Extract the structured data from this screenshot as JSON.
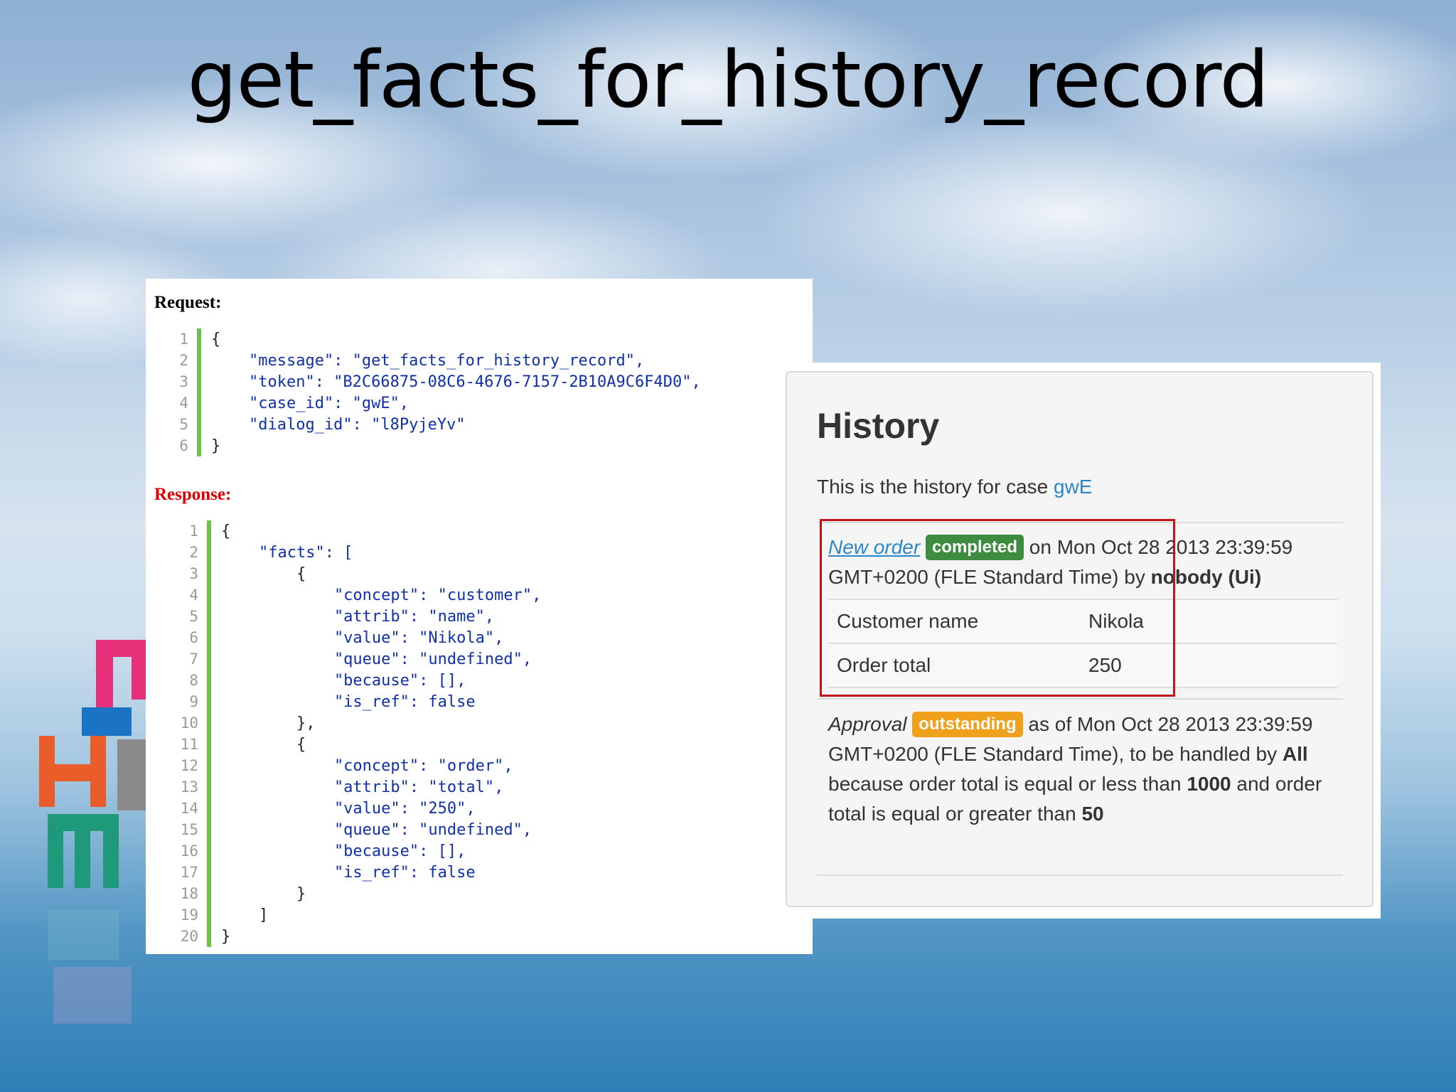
{
  "slide": {
    "title": "get_facts_for_history_record"
  },
  "request": {
    "label": "Request:",
    "lines": [
      {
        "n": "1",
        "text": "{"
      },
      {
        "n": "2",
        "text": "    \"message\": \"get_facts_for_history_record\","
      },
      {
        "n": "3",
        "text": "    \"token\": \"B2C66875-08C6-4676-7157-2B10A9C6F4D0\","
      },
      {
        "n": "4",
        "text": "    \"case_id\": \"gwE\","
      },
      {
        "n": "5",
        "text": "    \"dialog_id\": \"l8PyjeYv\""
      },
      {
        "n": "6",
        "text": "}"
      }
    ]
  },
  "response": {
    "label": "Response:",
    "lines": [
      {
        "n": "1",
        "text": "{"
      },
      {
        "n": "2",
        "text": "    \"facts\": ["
      },
      {
        "n": "3",
        "text": "        {"
      },
      {
        "n": "4",
        "text": "            \"concept\": \"customer\","
      },
      {
        "n": "5",
        "text": "            \"attrib\": \"name\","
      },
      {
        "n": "6",
        "text": "            \"value\": \"Nikola\","
      },
      {
        "n": "7",
        "text": "            \"queue\": \"undefined\","
      },
      {
        "n": "8",
        "text": "            \"because\": [],"
      },
      {
        "n": "9",
        "text": "            \"is_ref\": false"
      },
      {
        "n": "10",
        "text": "        },"
      },
      {
        "n": "11",
        "text": "        {"
      },
      {
        "n": "12",
        "text": "            \"concept\": \"order\","
      },
      {
        "n": "13",
        "text": "            \"attrib\": \"total\","
      },
      {
        "n": "14",
        "text": "            \"value\": \"250\","
      },
      {
        "n": "15",
        "text": "            \"queue\": \"undefined\","
      },
      {
        "n": "16",
        "text": "            \"because\": [],"
      },
      {
        "n": "17",
        "text": "            \"is_ref\": false"
      },
      {
        "n": "18",
        "text": "        }"
      },
      {
        "n": "19",
        "text": "    ]"
      },
      {
        "n": "20",
        "text": "}"
      }
    ]
  },
  "history": {
    "title": "History",
    "intro_text": "This is the history for case ",
    "case_link": "gwE",
    "entry1": {
      "name_link": "New order",
      "badge": "completed",
      "line1_rest": " on Mon Oct 28 2013 23:39:59",
      "line2_pre": "GMT+0200 (FLE Standard Time) by ",
      "by": "nobody (Ui)",
      "facts": [
        {
          "label": "Customer name",
          "value": "Nikola"
        },
        {
          "label": "Order total",
          "value": "250"
        }
      ]
    },
    "entry2": {
      "name": "Approval",
      "badge": "outstanding",
      "t1": " as of Mon Oct 28 2013 23:39:59 GMT+0200 (FLE Standard Time), to be handled by ",
      "b1": "All",
      "t2": " because order total is equal or less than ",
      "b2": "1000",
      "t3": " and order total is equal or greater than ",
      "b3": "50"
    }
  },
  "colors": {
    "badge_completed": "#3d8c40",
    "badge_outstanding": "#f0a01a",
    "link": "#2a87c9",
    "highlight": "#c0141c",
    "response_label": "#e00000"
  }
}
